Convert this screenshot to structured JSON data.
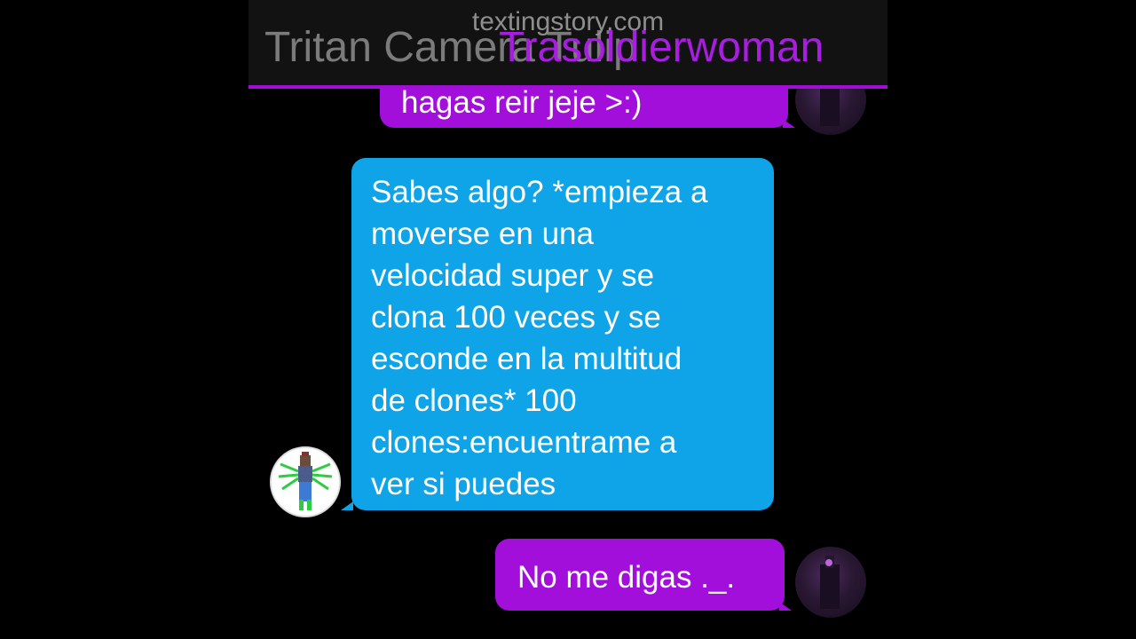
{
  "header": {
    "watermark": "textingstory.com",
    "contact_left": "Tritan Camera Tulip",
    "contact_right": "Trasoldierwoman"
  },
  "messages": [
    {
      "sender": "sent",
      "text": "hagas reir jeje >:)"
    },
    {
      "sender": "received",
      "lines": [
        "Sabes algo? *empieza a",
        "moverse en una",
        "velocidad super y se",
        "clona 100 veces y se",
        "esconde en la multitud",
        "de clones*  100",
        "clones:encuentrame a",
        "ver si puedes"
      ]
    },
    {
      "sender": "sent",
      "text": "No me digas ._."
    }
  ],
  "colors": {
    "sent_bubble": "#a20fdb",
    "received_bubble": "#0fa3e8",
    "header_accent": "#a00ed6",
    "background": "#000000"
  },
  "icons": {
    "sent_avatar": "dark-figure-avatar",
    "received_avatar": "green-robot-avatar"
  }
}
